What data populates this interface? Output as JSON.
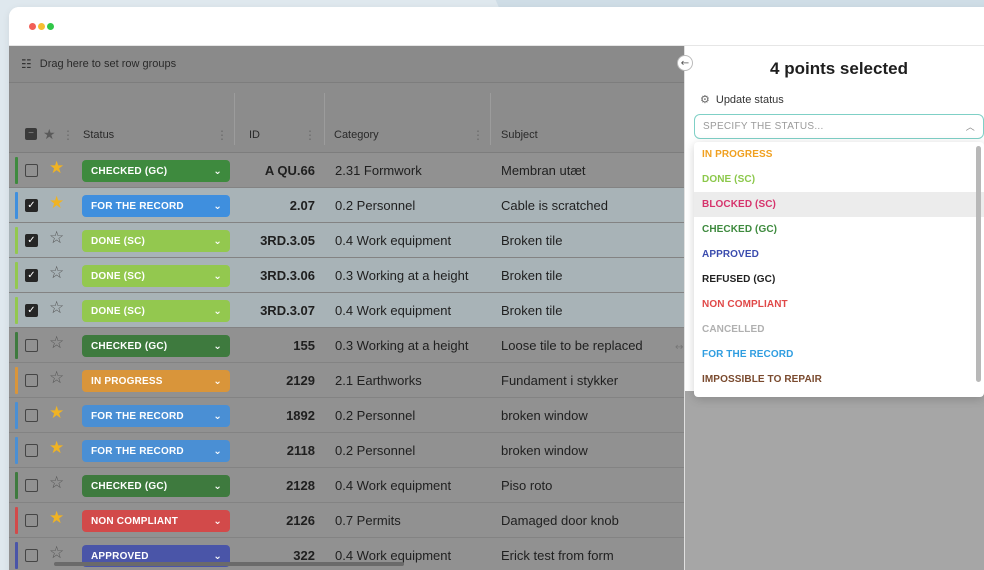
{
  "window": {
    "controls": [
      "close",
      "minimize",
      "maximize"
    ]
  },
  "grid": {
    "group_panel_text": "Drag here to set row groups",
    "columns": {
      "status": "Status",
      "id": "ID",
      "category": "Category",
      "subject": "Subject"
    },
    "rows": [
      {
        "selected": false,
        "starred": true,
        "status": "CHECKED (GC)",
        "color": "#3e8a3e",
        "id": "A QU.66",
        "category": "2.31 Formwork",
        "subject": "Membran utæt"
      },
      {
        "selected": true,
        "starred": true,
        "status": "FOR THE RECORD",
        "color": "#3f8fde",
        "id": "2.07",
        "category": "0.2 Personnel",
        "subject": "Cable is scratched"
      },
      {
        "selected": true,
        "starred": false,
        "status": "DONE (SC)",
        "color": "#93c84f",
        "id": "3RD.3.05",
        "category": "0.4 Work equipment",
        "subject": "Broken tile"
      },
      {
        "selected": true,
        "starred": false,
        "status": "DONE (SC)",
        "color": "#93c84f",
        "id": "3RD.3.06",
        "category": "0.3 Working at a height",
        "subject": "Broken tile"
      },
      {
        "selected": true,
        "starred": false,
        "status": "DONE (SC)",
        "color": "#93c84f",
        "id": "3RD.3.07",
        "category": "0.4 Work equipment",
        "subject": "Broken tile"
      },
      {
        "selected": false,
        "starred": false,
        "status": "CHECKED (GC)",
        "color": "#3e7a3e",
        "id": "155",
        "category": "0.3 Working at a height",
        "subject": "Loose tile to be replaced"
      },
      {
        "selected": false,
        "starred": false,
        "status": "IN PROGRESS",
        "color": "#d9953a",
        "id": "2129",
        "category": "2.1 Earthworks",
        "subject": "Fundament i stykker"
      },
      {
        "selected": false,
        "starred": true,
        "status": "FOR THE RECORD",
        "color": "#4a8fd4",
        "id": "1892",
        "category": "0.2 Personnel",
        "subject": "broken window"
      },
      {
        "selected": false,
        "starred": true,
        "status": "FOR THE RECORD",
        "color": "#4a8fd4",
        "id": "2118",
        "category": "0.2 Personnel",
        "subject": "broken window"
      },
      {
        "selected": false,
        "starred": false,
        "status": "CHECKED (GC)",
        "color": "#3e7a3e",
        "id": "2128",
        "category": "0.4 Work equipment",
        "subject": "Piso roto"
      },
      {
        "selected": false,
        "starred": true,
        "status": "NON COMPLIANT",
        "color": "#d24a4a",
        "id": "2126",
        "category": "0.7 Permits",
        "subject": "Damaged door knob"
      },
      {
        "selected": false,
        "starred": false,
        "status": "APPROVED",
        "color": "#4a55a8",
        "id": "322",
        "category": "0.4 Work equipment",
        "subject": "Erick test from form"
      }
    ]
  },
  "panel": {
    "title": "4 points selected",
    "update_label": "Update status",
    "select_placeholder": "SPECIFY THE STATUS...",
    "options": [
      {
        "label": "IN PROGRESS",
        "color": "#f0a020"
      },
      {
        "label": "DONE (SC)",
        "color": "#8cc84b"
      },
      {
        "label": "BLOCKED (SC)",
        "color": "#d6336c",
        "hover": true
      },
      {
        "label": "CHECKED (GC)",
        "color": "#3e8a3e"
      },
      {
        "label": "APPROVED",
        "color": "#3b4cae"
      },
      {
        "label": "REFUSED (GC)",
        "color": "#1f1f1f"
      },
      {
        "label": "NON COMPLIANT",
        "color": "#e04848"
      },
      {
        "label": "CANCELLED",
        "color": "#b0b0b0"
      },
      {
        "label": "FOR THE RECORD",
        "color": "#2f9de0"
      },
      {
        "label": "IMPOSSIBLE TO REPAIR",
        "color": "#7a4a2e"
      }
    ]
  }
}
